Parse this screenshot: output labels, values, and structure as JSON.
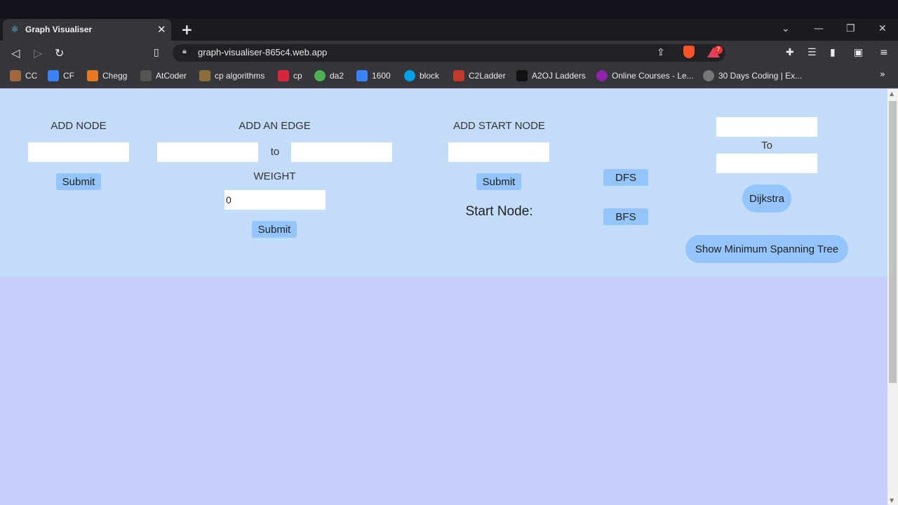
{
  "browser": {
    "tab_title": "Graph Visualiser",
    "url": "graph-visualiser-865c4.web.app",
    "notification_badge": "7",
    "bookmarks": [
      {
        "label": "CC",
        "color": "#a0683c"
      },
      {
        "label": "CF",
        "color": "#3b82f6"
      },
      {
        "label": "Chegg",
        "color": "#e87722"
      },
      {
        "label": "AtCoder",
        "color": "#555555"
      },
      {
        "label": "cp algorithms",
        "color": "#8a6d3b"
      },
      {
        "label": "cp",
        "color": "#d6263a"
      },
      {
        "label": "da2",
        "color": "#4caf50"
      },
      {
        "label": "1600",
        "color": "#3b82f6"
      },
      {
        "label": "block",
        "color": "#00a0e9"
      },
      {
        "label": "C2Ladder",
        "color": "#c0392b"
      },
      {
        "label": "A2OJ Ladders",
        "color": "#111111"
      },
      {
        "label": "Online Courses - Le...",
        "color": "#8e24aa"
      },
      {
        "label": "30 Days Coding | Ex...",
        "color": "#777777"
      }
    ]
  },
  "add_node": {
    "title": "ADD NODE",
    "input_value": "",
    "submit_label": "Submit"
  },
  "add_edge": {
    "title": "ADD AN EDGE",
    "from_value": "",
    "to_label": "to",
    "to_value": "",
    "weight_label": "WEIGHT",
    "weight_value": "0",
    "submit_label": "Submit"
  },
  "add_start_node": {
    "title": "ADD START NODE",
    "input_value": "",
    "submit_label": "Submit",
    "start_node_label": "Start Node:"
  },
  "traversal": {
    "dfs_label": "DFS",
    "bfs_label": "BFS"
  },
  "shortest_path": {
    "from_value": "",
    "to_label": "To",
    "to_value": "",
    "dijkstra_label": "Dijkstra",
    "mst_label": "Show Minimum Spanning Tree"
  }
}
